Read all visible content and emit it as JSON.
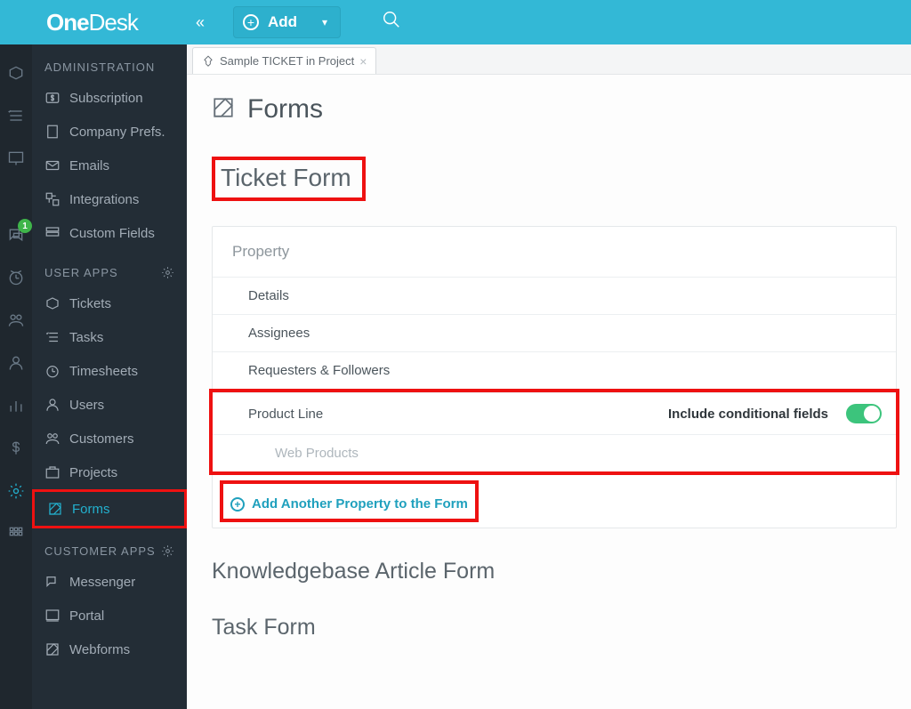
{
  "brand": {
    "part1": "One",
    "part2": "Desk"
  },
  "topbar": {
    "add": "Add"
  },
  "rail_badge": "1",
  "sidebar": {
    "sections": {
      "admin": "ADMINISTRATION",
      "userapps": "USER APPS",
      "custapps": "CUSTOMER APPS"
    },
    "items": {
      "subscription": "Subscription",
      "companyprefs": "Company Prefs.",
      "emails": "Emails",
      "integrations": "Integrations",
      "customfields": "Custom Fields",
      "tickets": "Tickets",
      "tasks": "Tasks",
      "timesheets": "Timesheets",
      "users": "Users",
      "customers": "Customers",
      "projects": "Projects",
      "forms": "Forms",
      "messenger": "Messenger",
      "portal": "Portal",
      "webforms": "Webforms"
    }
  },
  "tab": {
    "label": "Sample TICKET in Project"
  },
  "page": {
    "title": "Forms"
  },
  "ticketform": {
    "title": "Ticket Form",
    "property_header": "Property",
    "rows": {
      "details": "Details",
      "assignees": "Assignees",
      "requesters": "Requesters & Followers",
      "productline": "Product Line",
      "webproducts": "Web Products"
    },
    "conditional_label": "Include conditional fields",
    "add_another": "Add Another Property to the Form"
  },
  "kb": {
    "title": "Knowledgebase Article Form"
  },
  "task": {
    "title": "Task Form"
  }
}
